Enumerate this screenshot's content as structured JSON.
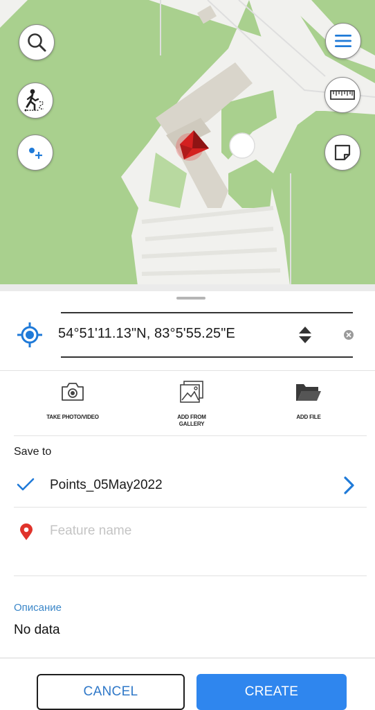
{
  "map": {
    "buttons": {
      "search": "search-icon",
      "track": "walking-track-icon",
      "add_point": "add-point-icon",
      "menu": "menu-icon",
      "ruler": "ruler-icon",
      "layers": "note-icon"
    },
    "location_marker": "compass-arrow-icon"
  },
  "coordinates": {
    "value": "54°51'11.13\"N, 83°5'55.25\"E"
  },
  "actions": [
    {
      "label": "TAKE PHOTO/VIDEO",
      "icon": "camera-icon"
    },
    {
      "label": "ADD FROM GALLERY",
      "icon": "gallery-icon"
    },
    {
      "label": "ADD FILE",
      "icon": "folder-icon"
    }
  ],
  "save_to": {
    "label": "Save to",
    "value": "Points_05May2022"
  },
  "feature": {
    "value": "",
    "placeholder": "Feature name"
  },
  "description": {
    "label": "Описание",
    "value": "No data"
  },
  "buttons": {
    "cancel": "CANCEL",
    "create": "CREATE"
  },
  "colors": {
    "accent": "#2f86ee",
    "link": "#2f78c8",
    "map_green": "#a9d08e",
    "marker_red": "#d42020",
    "pin_red": "#e0332b"
  }
}
